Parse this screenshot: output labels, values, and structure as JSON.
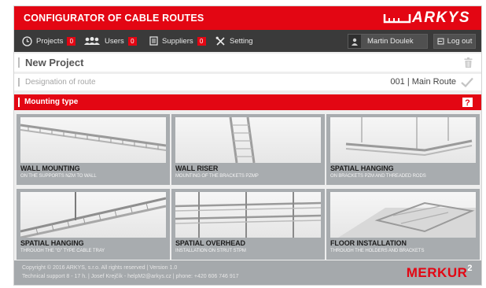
{
  "header": {
    "title": "CONFIGURATOR OF CABLE ROUTES",
    "logo_text": "ARKYS",
    "brand_color": "#e30613"
  },
  "nav": {
    "items": [
      {
        "label": "Projects",
        "count": "0",
        "icon": "projects-icon"
      },
      {
        "label": "Users",
        "count": "0",
        "icon": "users-icon"
      },
      {
        "label": "Suppliers",
        "count": "0",
        "icon": "suppliers-icon"
      },
      {
        "label": "Setting",
        "icon": "tools-icon"
      }
    ],
    "user_name": "Martin Doulek",
    "logout_label": "Log out"
  },
  "project": {
    "title": "New Project",
    "designation_label": "Designation of route",
    "route_value": "001 | Main Route"
  },
  "mounting": {
    "label": "Mounting type"
  },
  "tiles": [
    {
      "title": "WALL MOUNTING",
      "subtitle": "ON THE SUPPORTS NZM TO WALL"
    },
    {
      "title": "WALL RISER",
      "subtitle": "MOUNTING OF THE BRACKETS PZMP"
    },
    {
      "title": "SPATIAL HANGING",
      "subtitle": "ON BRACKETS PZM AND THREADED RODS"
    },
    {
      "title": "SPATIAL HANGING",
      "subtitle": "THROUGH THE \"G\" TYPE CABLE TRAY"
    },
    {
      "title": "SPATIAL OVERHEAD",
      "subtitle": "INSTALLATION ON STRUT STPM"
    },
    {
      "title": "FLOOR INSTALLATION",
      "subtitle": "THROUGH THE HOLDERS AND BRACKETS"
    }
  ],
  "footer": {
    "copyright": "Copyright © 2016 ARKYS, s.r.o. All rights reserved | Version 1.0",
    "support": "Technical support 8 - 17 h. | Josef Krejčík - helpM2@arkys.cz | phone: +420 606 746 917",
    "brand": "MERKUR",
    "brand_sup": "2"
  }
}
